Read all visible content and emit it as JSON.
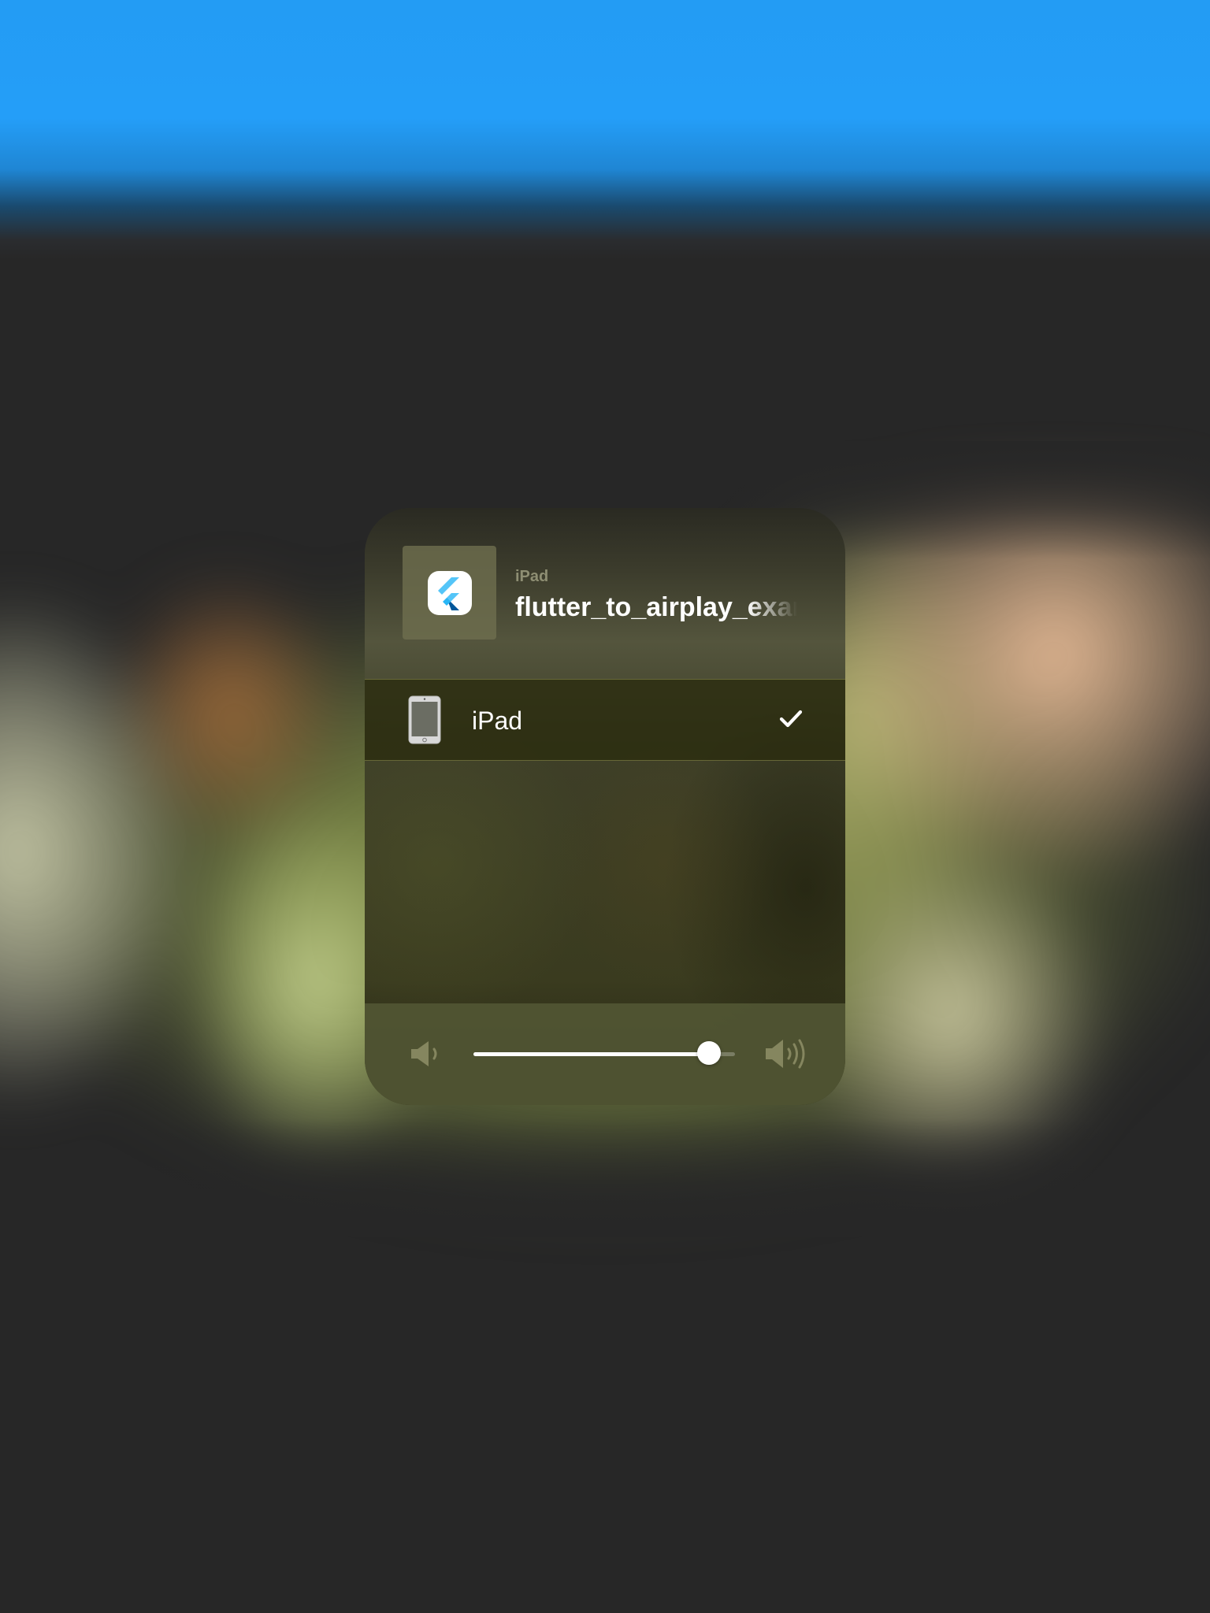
{
  "now_playing": {
    "device_caption": "iPad",
    "title": "flutter_to_airplay_exam",
    "artwork_icon": "flutter-logo-icon"
  },
  "routes": [
    {
      "label": "iPad",
      "icon": "ipad-device-icon",
      "selected": true
    }
  ],
  "volume": {
    "level": 0.9,
    "min_icon": "speaker-low-icon",
    "max_icon": "speaker-high-icon"
  },
  "colors": {
    "background": "#272727",
    "top_bar_blue": "#239cf4",
    "flutter_light_blue": "#54c5f8",
    "flutter_dark_blue": "#01579b"
  }
}
